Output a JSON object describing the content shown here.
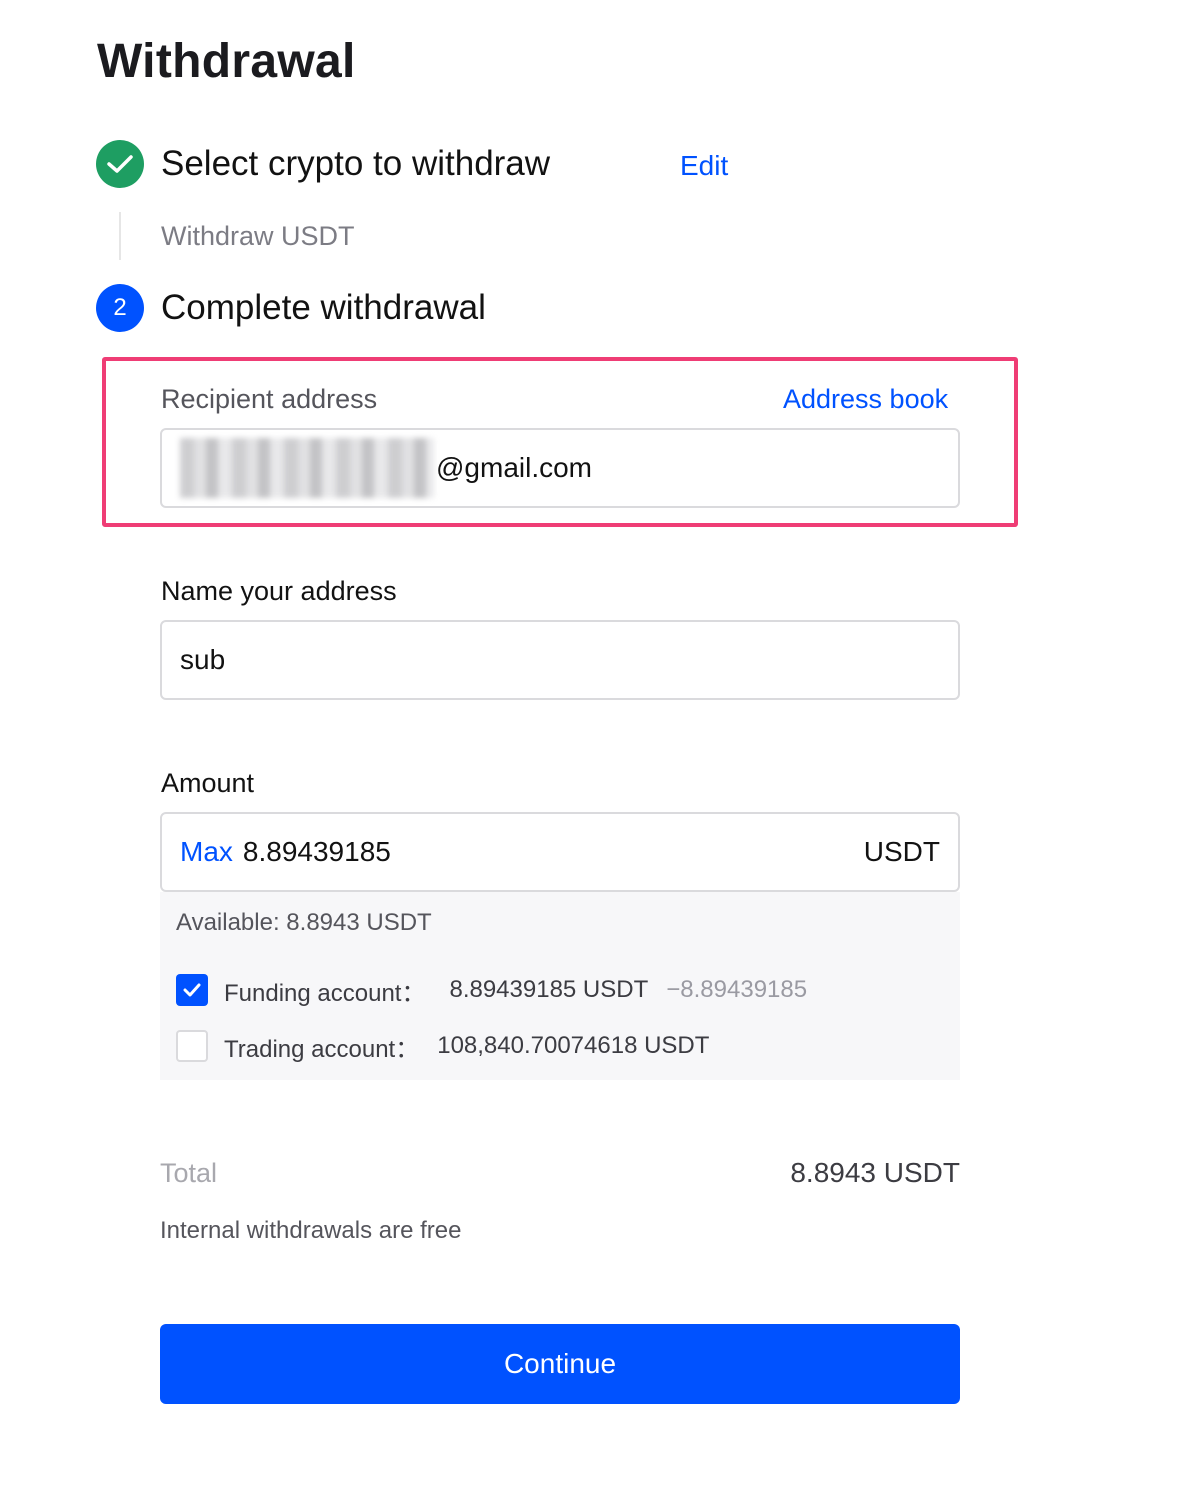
{
  "page": {
    "title": "Withdrawal"
  },
  "steps": {
    "step1": {
      "title": "Select crypto to withdraw",
      "edit_label": "Edit",
      "subtitle": "Withdraw USDT",
      "status_icon": "check-icon"
    },
    "step2": {
      "number": "2",
      "title": "Complete withdrawal"
    }
  },
  "recipient": {
    "label": "Recipient address",
    "address_book_label": "Address book",
    "value_visible": "@gmail.com"
  },
  "address_name": {
    "label": "Name your address",
    "value": "sub"
  },
  "amount": {
    "label": "Amount",
    "max_label": "Max",
    "value": "8.89439185",
    "unit": "USDT"
  },
  "balances": {
    "available": "Available:  8.8943 USDT",
    "funding": {
      "label": "Funding account：",
      "value": "8.89439185 USDT",
      "delta": "−8.89439185",
      "checked": true
    },
    "trading": {
      "label": "Trading account：",
      "value": "108,840.70074618 USDT",
      "checked": false
    }
  },
  "summary": {
    "total_label": "Total",
    "total_value": "8.8943 USDT",
    "fee_note": "Internal withdrawals are free"
  },
  "actions": {
    "continue_label": "Continue"
  },
  "colors": {
    "accent": "#0052ff",
    "success": "#1e9e62",
    "highlight": "#ef3d75"
  }
}
